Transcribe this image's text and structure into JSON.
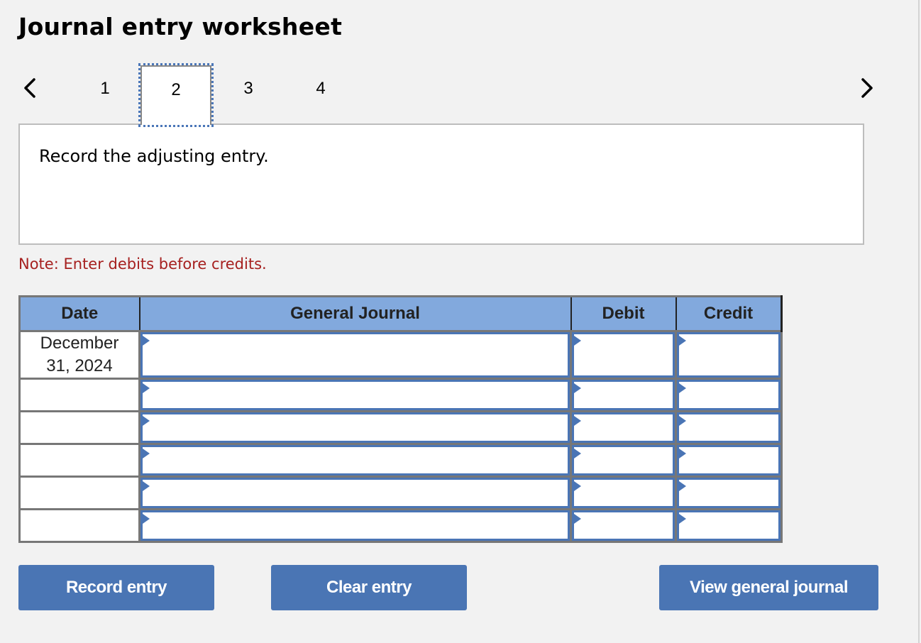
{
  "page": {
    "title": "Journal entry worksheet"
  },
  "navigation": {
    "prev_icon": "chevron-left-icon",
    "next_icon": "chevron-right-icon",
    "tabs": [
      {
        "label": "1",
        "active": false
      },
      {
        "label": "2",
        "active": true
      },
      {
        "label": "3",
        "active": false
      },
      {
        "label": "4",
        "active": false
      }
    ]
  },
  "instructions": {
    "text": "Record the adjusting entry."
  },
  "note": {
    "text": "Note: Enter debits before credits.",
    "color": "#a6201f"
  },
  "journal_table": {
    "headers": {
      "date": "Date",
      "general_journal": "General Journal",
      "debit": "Debit",
      "credit": "Credit"
    },
    "rows": [
      {
        "date_line1": "December",
        "date_line2": "31, 2024",
        "account": "",
        "debit": "",
        "credit": ""
      },
      {
        "date_line1": "",
        "date_line2": "",
        "account": "",
        "debit": "",
        "credit": ""
      },
      {
        "date_line1": "",
        "date_line2": "",
        "account": "",
        "debit": "",
        "credit": ""
      },
      {
        "date_line1": "",
        "date_line2": "",
        "account": "",
        "debit": "",
        "credit": ""
      },
      {
        "date_line1": "",
        "date_line2": "",
        "account": "",
        "debit": "",
        "credit": ""
      },
      {
        "date_line1": "",
        "date_line2": "",
        "account": "",
        "debit": "",
        "credit": ""
      }
    ],
    "header_color": "#82a9dd",
    "field_border_color": "#4a75b5"
  },
  "buttons": {
    "record_entry": "Record entry",
    "clear_entry": "Clear entry",
    "view_general_journal": "View general journal",
    "color": "#4a75b4"
  }
}
